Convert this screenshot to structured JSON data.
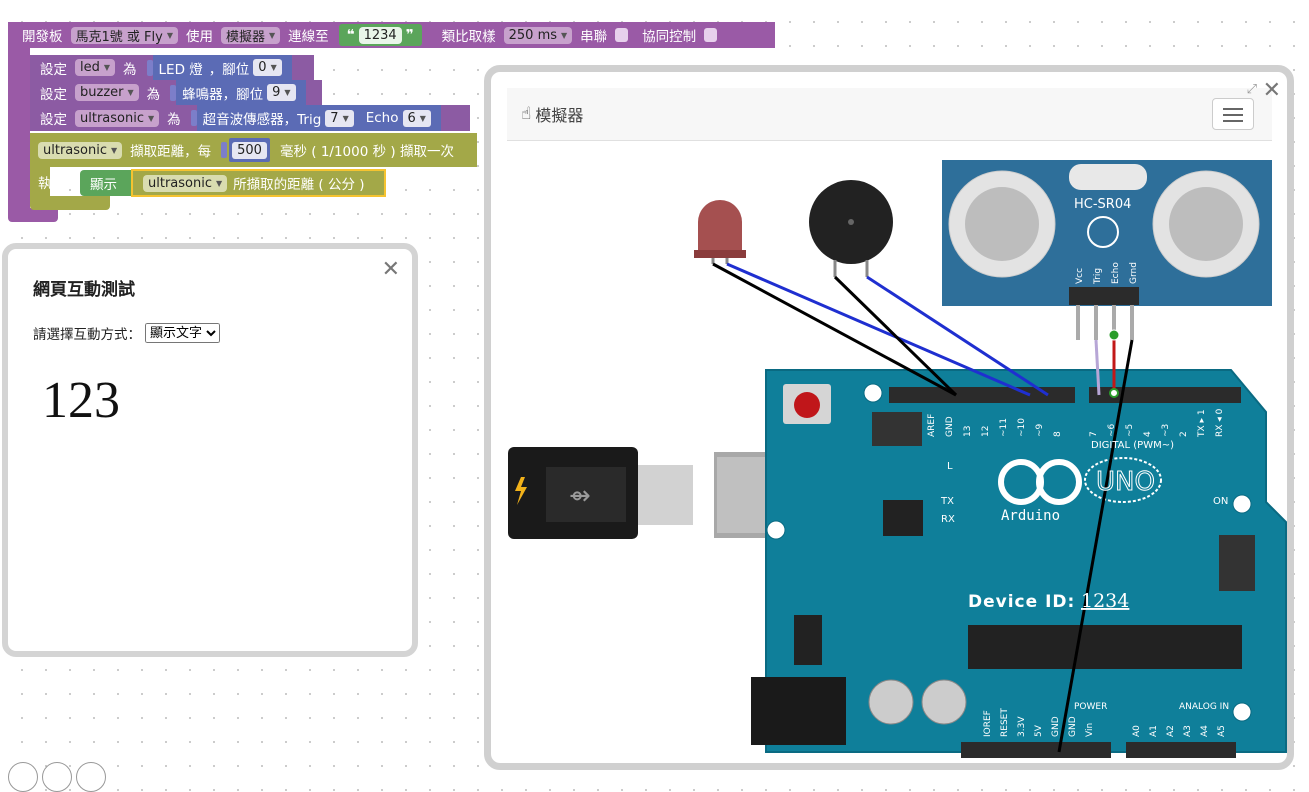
{
  "blocks": {
    "board": {
      "label1": "開發板",
      "board_value": "馬克1號 或 Fly",
      "label2": "使用",
      "mode_value": "模擬器",
      "label3": "連線至",
      "device_id": "1234",
      "label4": "類比取樣",
      "sample_value": "250 ms",
      "label5": "串聯",
      "label6": "協同控制"
    },
    "set_led": {
      "label1": "設定",
      "var": "led",
      "label2": "為",
      "component": "LED 燈",
      "pin_label": "，腳位",
      "pin": "0"
    },
    "set_buzzer": {
      "label1": "設定",
      "var": "buzzer",
      "label2": "為",
      "component": "蜂鳴器，腳位",
      "pin": "9"
    },
    "set_ultrasonic": {
      "label1": "設定",
      "var": "ultrasonic",
      "label2": "為",
      "component": "超音波傳感器，Trig",
      "trig": "7",
      "echo_label": "Echo",
      "echo": "6"
    },
    "ultra_read": {
      "var": "ultrasonic",
      "label1": "擷取距離，每",
      "interval": "500",
      "label2": "毫秒 ( 1/1000 秒 ) 擷取一次"
    },
    "exec": {
      "label": "執行",
      "show_label": "顯示",
      "var": "ultrasonic",
      "distance_label": "所擷取的距離 ( 公分 )"
    }
  },
  "webpanel": {
    "title": "網頁互動測試",
    "select_label": "請選擇互動方式：",
    "select_value": "顯示文字",
    "display_value": "123"
  },
  "simulator": {
    "title": "模擬器",
    "sensor_name": "HC-SR04",
    "sensor_pins": [
      "Vcc",
      "Trig",
      "Echo",
      "Grnd"
    ],
    "device_id_label": "Device ID:",
    "device_id": "1234",
    "board_uno": "UNO",
    "board_brand": "Arduino",
    "digital_label": "DIGITAL (PWM~)",
    "power_label": "POWER",
    "analog_label": "ANALOG IN",
    "on_label": "ON",
    "led_labels": [
      "L",
      "TX",
      "RX"
    ],
    "top_pins": [
      "AREF",
      "GND",
      "13",
      "12",
      "~11",
      "~10",
      "~9",
      "8",
      "7",
      "~6",
      "~5",
      "4",
      "~3",
      "2",
      "TX ▸ 1",
      "RX ◂ 0"
    ],
    "power_pins": [
      "IOREF",
      "RESET",
      "3.3V",
      "5V",
      "GND",
      "GND",
      "Vin"
    ],
    "analog_pins": [
      "A0",
      "A1",
      "A2",
      "A3",
      "A4",
      "A5"
    ]
  },
  "colors": {
    "board_blue": "#0f7f9a",
    "wire_blue": "#1f2fd0",
    "wire_black": "#000000",
    "wire_red": "#c21818",
    "block_purple": "#9a5aa6"
  }
}
